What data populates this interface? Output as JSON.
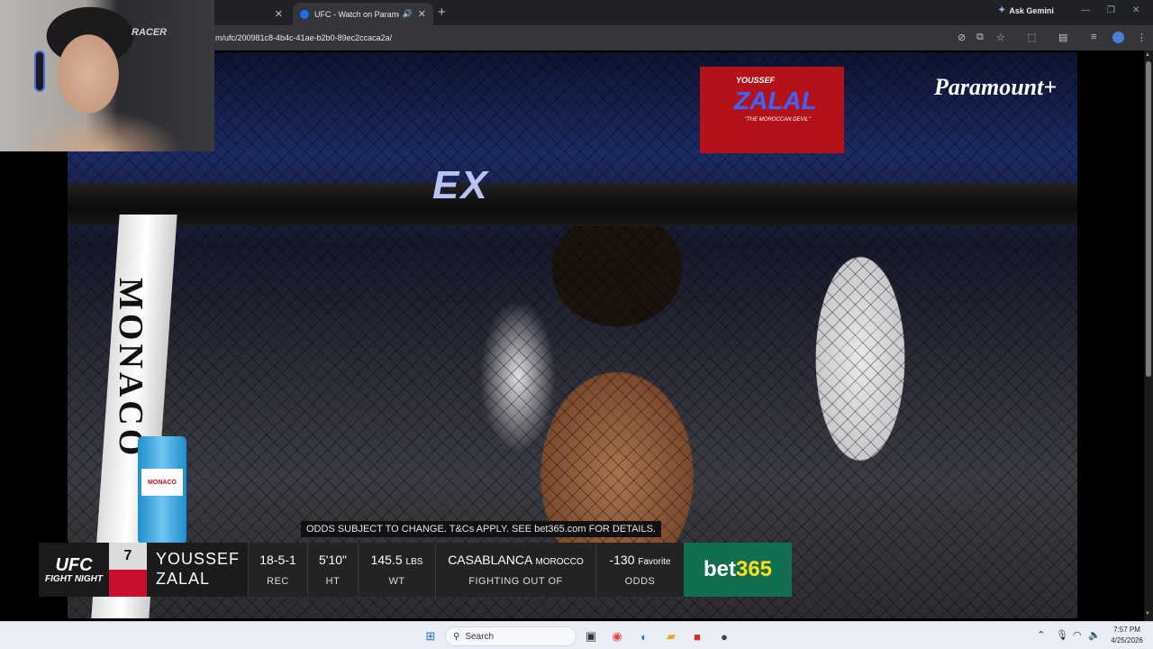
{
  "browser": {
    "tabs": [
      {
        "title": "",
        "active": false
      },
      {
        "title": "UFC - Watch on Paramount",
        "active": true
      }
    ],
    "ask_label": "Ask Gemini",
    "url": "m/ufc/200981c8-4b4c-41ae-b2b0-89ec2ccaca2a/"
  },
  "video": {
    "rail_text": "EX",
    "post_label": "MONACO",
    "can_label": "MONACO",
    "screen": {
      "line1": "YOUSSEF",
      "line2": "ZALAL",
      "line3": "\"THE MOROCCAN DEVIL\""
    },
    "brand": "Paramount+",
    "webcam_chair_text": "RACER"
  },
  "lower_third": {
    "odds_note": "ODDS SUBJECT TO CHANGE. T&Cs APPLY. SEE bet365.com FOR DETAILS.",
    "logo_top": "UFC",
    "logo_bottom": "FIGHT NIGHT",
    "rank": "7",
    "first_name": "YOUSSEF",
    "last_name": "ZALAL",
    "record": {
      "value": "18-5-1",
      "label": "REC"
    },
    "height": {
      "value": "5'10\"",
      "label": "HT"
    },
    "weight": {
      "value": "145.5",
      "unit": "LBS",
      "label": "WT"
    },
    "fighting_out_of": {
      "city": "CASABLANCA",
      "country": "MOROCCO",
      "label": "FIGHTING OUT OF"
    },
    "odds": {
      "value": "-130",
      "note": "Favorite",
      "label": "ODDS"
    },
    "sponsor_main": "bet",
    "sponsor_num": "365",
    "corner_color": "#c8102e",
    "sponsor_color": "#126e51"
  },
  "taskbar": {
    "search_placeholder": "Search",
    "time": "7:57 PM",
    "date": "4/25/2026"
  }
}
